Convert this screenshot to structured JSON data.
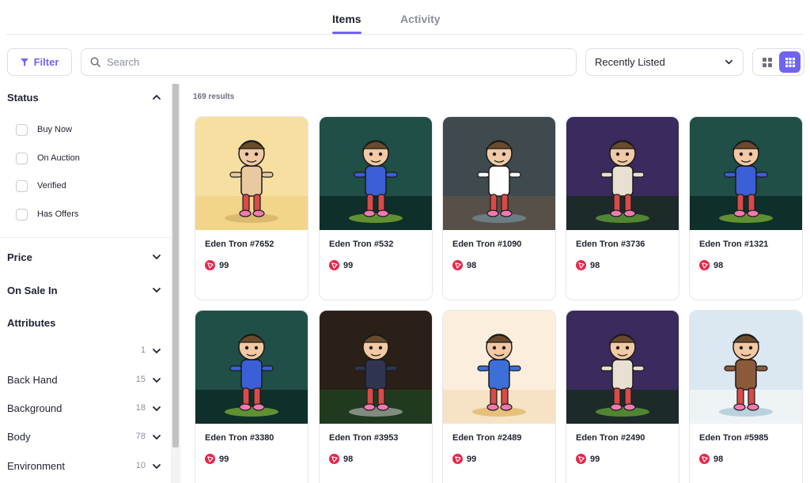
{
  "tabs": [
    {
      "label": "Items",
      "active": true
    },
    {
      "label": "Activity",
      "active": false
    }
  ],
  "toolbar": {
    "filter_label": "Filter",
    "search_placeholder": "Search",
    "search_value": "",
    "sort_value": "Recently Listed",
    "view_mode": "small-grid"
  },
  "sidebar": {
    "status_heading": "Status",
    "status_options": [
      "Buy Now",
      "On Auction",
      "Verified",
      "Has Offers"
    ],
    "price_heading": "Price",
    "on_sale_heading": "On Sale In",
    "attributes_heading": "Attributes",
    "attributes": [
      {
        "name": "",
        "count": "1"
      },
      {
        "name": "Back Hand",
        "count": "15"
      },
      {
        "name": "Background",
        "count": "18"
      },
      {
        "name": "Body",
        "count": "78"
      },
      {
        "name": "Environment",
        "count": "10"
      }
    ]
  },
  "results": {
    "count_label": "169 results",
    "items": [
      {
        "name": "Eden Tron #7652",
        "price": "99",
        "theme": "desert"
      },
      {
        "name": "Eden Tron #532",
        "price": "99",
        "theme": "green"
      },
      {
        "name": "Eden Tron #1090",
        "price": "98",
        "theme": "cave"
      },
      {
        "name": "Eden Tron #3736",
        "price": "98",
        "theme": "purple"
      },
      {
        "name": "Eden Tron #1321",
        "price": "98",
        "theme": "green"
      },
      {
        "name": "Eden Tron #3380",
        "price": "99",
        "theme": "green"
      },
      {
        "name": "Eden Tron #3953",
        "price": "98",
        "theme": "city"
      },
      {
        "name": "Eden Tron #2489",
        "price": "99",
        "theme": "cream"
      },
      {
        "name": "Eden Tron #2490",
        "price": "99",
        "theme": "purple"
      },
      {
        "name": "Eden Tron #5985",
        "price": "98",
        "theme": "sky"
      }
    ]
  },
  "colors": {
    "accent": "#6f63f0",
    "tron_red": "#e7264a",
    "border": "#dcdde6"
  }
}
